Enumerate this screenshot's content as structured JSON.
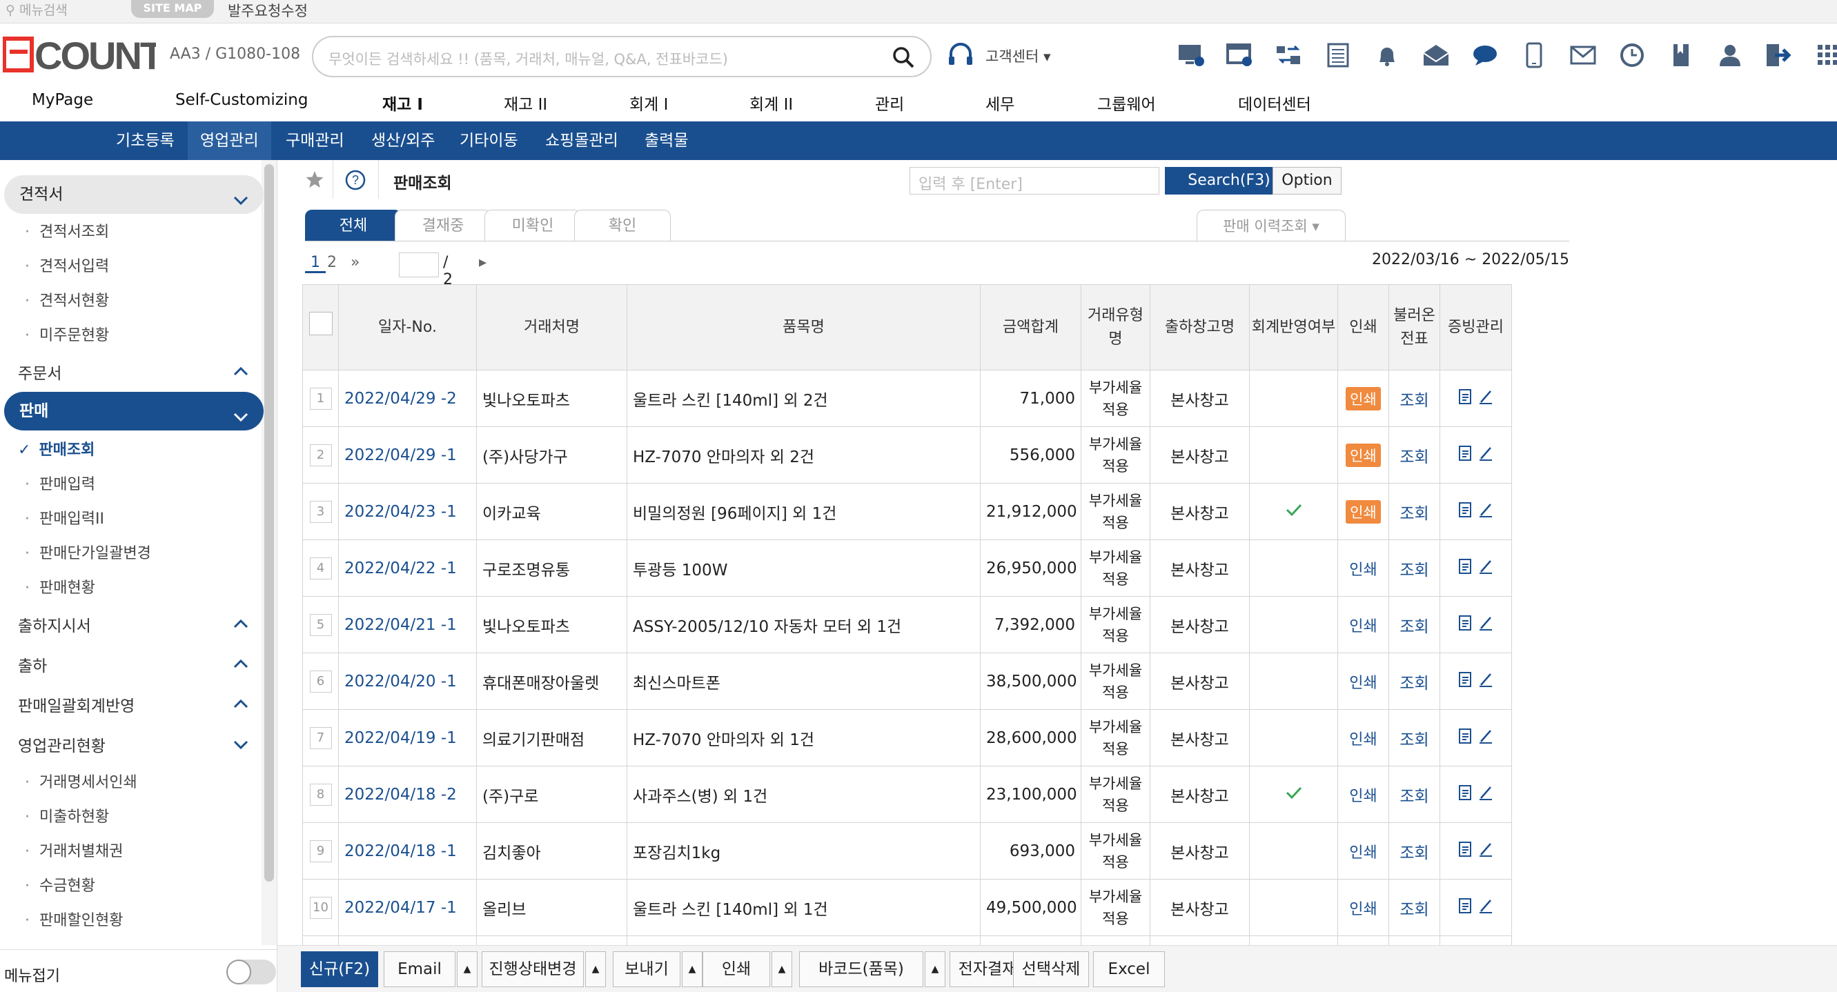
{
  "topbar": {
    "menu_search": "메뉴검색",
    "site_map": "SITE MAP",
    "order_edit": "발주요청수정"
  },
  "header": {
    "account": "AA3 / G1080-108",
    "search_placeholder": "무엇이든 검색하세요 !! (품목, 거래처, 매뉴얼, Q&A, 전표바코드)",
    "support_label": "고객센터",
    "icons": [
      "monitor-icon",
      "new-window-icon",
      "transfer-icon",
      "document-icon",
      "bell-icon",
      "mail-open-icon",
      "chat-icon",
      "mobile-icon",
      "envelope-icon",
      "clock-icon",
      "bookmark-icon",
      "user-icon",
      "logout-icon",
      "grid-icon"
    ]
  },
  "main_nav": [
    "MyPage",
    "Self-Customizing",
    "재고 I",
    "재고 II",
    "회계 I",
    "회계 II",
    "관리",
    "세무",
    "그룹웨어",
    "데이터센터"
  ],
  "sub_nav": [
    "기초등록",
    "영업관리",
    "구매관리",
    "생산/외주",
    "기타이동",
    "쇼핑몰관리",
    "출력물"
  ],
  "sidebar": {
    "quote_header": "견적서",
    "quote_items": [
      "견적서조회",
      "견적서입력",
      "견적서현황",
      "미주문현황"
    ],
    "order": "주문서",
    "sales_header": "판매",
    "sales_items": [
      "판매조회",
      "판매입력",
      "판매입력II",
      "판매단가일괄변경",
      "판매현황"
    ],
    "ship_order": "출하지시서",
    "shipping": "출하",
    "sales_batch": "판매일괄회계반영",
    "sales_status": "영업관리현황",
    "status_items": [
      "거래명세서인쇄",
      "미출하현황",
      "거래처별채권",
      "수금현황",
      "판매할인현황"
    ],
    "collapse_menu": "메뉴접기"
  },
  "toolbar": {
    "title": "판매조회",
    "input_placeholder": "입력 후 [Enter]",
    "search": "Search(F3)",
    "option": "Option"
  },
  "tabs": [
    "전체",
    "결재중",
    "미확인",
    "확인"
  ],
  "history_tab": "판매 이력조회",
  "pager": {
    "page1": "1",
    "page2": "2",
    "total": "/ 2"
  },
  "date_range": "2022/03/16 ~ 2022/05/15",
  "columns": {
    "date_no": "일자-No.",
    "customer": "거래처명",
    "item": "품목명",
    "amount": "금액합계",
    "trade_type": "거래유형명",
    "warehouse": "출하창고명",
    "accounting": "회계반영여부",
    "print": "인쇄",
    "loaded": "불러온 전표",
    "evidence": "증빙관리"
  },
  "rows": [
    {
      "n": "1",
      "date": "2022/04/29 -2",
      "customer": "빛나오토파츠",
      "item": "울트라 스킨 [140ml] 외 2건",
      "amount": "71,000",
      "type": "부가세율 적용",
      "wh": "본사창고",
      "acct": false,
      "print_hl": true
    },
    {
      "n": "2",
      "date": "2022/04/29 -1",
      "customer": "(주)사당가구",
      "item": "HZ-7070 안마의자 외 2건",
      "amount": "556,000",
      "type": "부가세율 적용",
      "wh": "본사창고",
      "acct": false,
      "print_hl": true
    },
    {
      "n": "3",
      "date": "2022/04/23 -1",
      "customer": "이카교육",
      "item": "비밀의정원 [96페이지] 외 1건",
      "amount": "21,912,000",
      "type": "부가세율 적용",
      "wh": "본사창고",
      "acct": true,
      "print_hl": true
    },
    {
      "n": "4",
      "date": "2022/04/22 -1",
      "customer": "구로조명유통",
      "item": "투광등 100W",
      "amount": "26,950,000",
      "type": "부가세율 적용",
      "wh": "본사창고",
      "acct": false,
      "print_hl": false
    },
    {
      "n": "5",
      "date": "2022/04/21 -1",
      "customer": "빛나오토파츠",
      "item": "ASSY-2005/12/10 자동차 모터 외 1건",
      "amount": "7,392,000",
      "type": "부가세율 적용",
      "wh": "본사창고",
      "acct": false,
      "print_hl": false
    },
    {
      "n": "6",
      "date": "2022/04/20 -1",
      "customer": "휴대폰매장아울렛",
      "item": "최신스마트폰",
      "amount": "38,500,000",
      "type": "부가세율 적용",
      "wh": "본사창고",
      "acct": false,
      "print_hl": false
    },
    {
      "n": "7",
      "date": "2022/04/19 -1",
      "customer": "의료기기판매점",
      "item": "HZ-7070 안마의자 외 1건",
      "amount": "28,600,000",
      "type": "부가세율 적용",
      "wh": "본사창고",
      "acct": false,
      "print_hl": false
    },
    {
      "n": "8",
      "date": "2022/04/18 -2",
      "customer": "(주)구로",
      "item": "사과주스(병) 외 1건",
      "amount": "23,100,000",
      "type": "부가세율 적용",
      "wh": "본사창고",
      "acct": true,
      "print_hl": false
    },
    {
      "n": "9",
      "date": "2022/04/18 -1",
      "customer": "김치좋아",
      "item": "포장김치1kg",
      "amount": "693,000",
      "type": "부가세율 적용",
      "wh": "본사창고",
      "acct": false,
      "print_hl": false
    },
    {
      "n": "10",
      "date": "2022/04/17 -1",
      "customer": "올리브",
      "item": "울트라 스킨 [140ml] 외 1건",
      "amount": "49,500,000",
      "type": "부가세율 적용",
      "wh": "본사창고",
      "acct": false,
      "print_hl": false
    }
  ],
  "row_labels": {
    "print": "인쇄",
    "view": "조회"
  },
  "bottom": {
    "new": "신규(F2)",
    "email": "Email",
    "status": "진행상태변경",
    "send": "보내기",
    "print": "인쇄",
    "barcode": "바코드(품목)",
    "approval": "전자결재",
    "delete": "선택삭제",
    "excel": "Excel"
  },
  "colors": {
    "brand_blue": "#1a4f8f",
    "logo_red": "#e8322b",
    "print_orange": "#f08a3e",
    "check_green": "#3aa655"
  }
}
